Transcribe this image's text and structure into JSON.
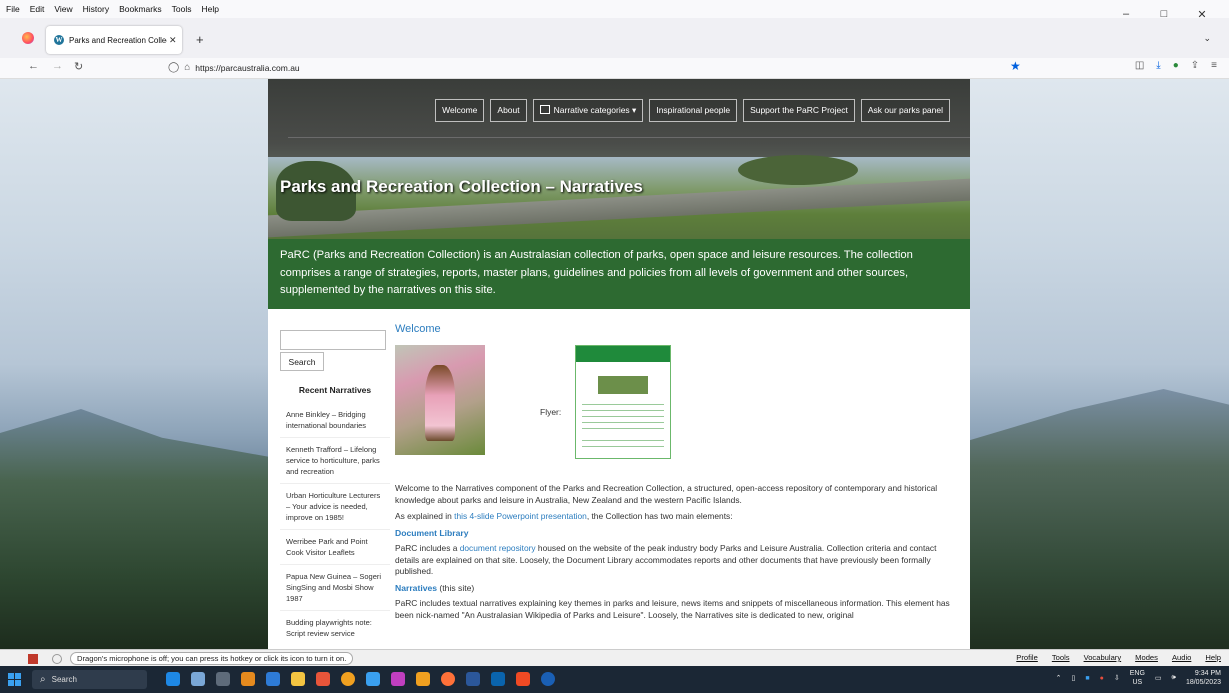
{
  "browser": {
    "menu": [
      "File",
      "Edit",
      "View",
      "History",
      "Bookmarks",
      "Tools",
      "Help"
    ],
    "window_controls": [
      "–",
      "□",
      "✕"
    ],
    "tab": {
      "title": "Parks and Recreation Collection",
      "close": "✕"
    },
    "new_tab": "+",
    "tab_list": "⌄",
    "url": "https://parcaustralia.com.au"
  },
  "site": {
    "nav": [
      "Welcome",
      "About",
      "Narrative categories ▾",
      "Inspirational people",
      "Support the PaRC Project",
      "Ask our parks panel"
    ],
    "hero_title": "Parks and Recreation Collection – Narratives",
    "intro": "PaRC (Parks and Recreation Collection) is an Australasian collection of parks, open space and leisure resources. The collection comprises a range of strategies, reports, master plans, guidelines and policies from all levels of government and other sources, supplemented by the narratives on this site.",
    "search_button": "Search",
    "recent_heading": "Recent Narratives",
    "recent": [
      "Anne Binkley – Bridging international boundaries",
      "Kenneth Trafford – Lifelong service to horticulture, parks and recreation",
      "Urban Horticulture Lecturers – Your advice is needed, improve on 1985!",
      "Werribee Park and Point Cook Visitor Leaflets",
      "Papua New Guinea – Sogeri SingSing and Mosbi Show 1987",
      "Budding playwrights note: Script review service"
    ],
    "content_title": "Welcome",
    "flyer_label": "Flyer:",
    "p1": "Welcome to the Narratives component of the Parks and Recreation Collection, a structured, open-access repository of contemporary and historical knowledge about parks and leisure in Australia, New Zealand and the western Pacific Islands.",
    "p2_a": "As explained in ",
    "p2_link": "this 4-slide Powerpoint presentation",
    "p2_b": ", the Collection has two main elements:",
    "sec1": "Document Library",
    "p3_a": "PaRC includes a ",
    "p3_link": "document repository",
    "p3_b": " housed on the website of the peak industry body Parks and Leisure Australia. Collection criteria and contact details are explained on that site. Loosely, the Document Library accommodates reports and other documents that have previously been formally published.",
    "sec2": "Narratives",
    "sec2_note": " (this site)",
    "p4": "PaRC includes textual narratives explaining key themes in parks and leisure, news items and snippets of miscellaneous information. This element has been nick-named \"An Australasian Wikipedia of Parks and Leisure\". Loosely, the Narratives site is dedicated to new, original"
  },
  "dragon": {
    "message": "Dragon's microphone is off; you can press its hotkey or click its icon to turn it on.",
    "menu": [
      "Profile",
      "Tools",
      "Vocabulary",
      "Modes",
      "Audio",
      "Help"
    ]
  },
  "taskbar": {
    "search": "Search",
    "lang_top": "ENG",
    "lang_bottom": "US",
    "time": "9:34 PM",
    "date": "18/05/2023"
  }
}
